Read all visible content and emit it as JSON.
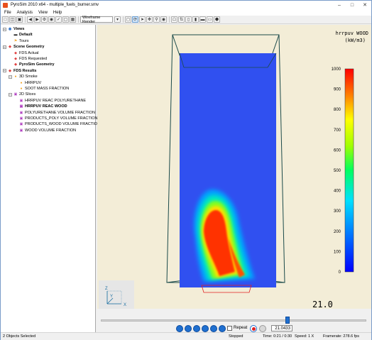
{
  "window": {
    "title": "PyroSim 2010 x64 - multiple_fuels_burner.smv"
  },
  "menu": [
    "File",
    "Analysis",
    "View",
    "Help"
  ],
  "toolbar": {
    "render_mode": "Wireframe Render"
  },
  "tree": {
    "items": [
      {
        "label": "Views",
        "bold": true,
        "icon": "views-icon",
        "level": 0
      },
      {
        "label": "Default",
        "bold": true,
        "icon": "view-icon",
        "level": 1
      },
      {
        "label": "Tours",
        "bold": false,
        "icon": "tour-icon",
        "level": 1
      },
      {
        "label": "Scene Geometry",
        "bold": true,
        "icon": "geometry-icon",
        "level": 0
      },
      {
        "label": "FDS Actual",
        "bold": false,
        "icon": "geometry-icon",
        "level": 1
      },
      {
        "label": "FDS Requested",
        "bold": false,
        "icon": "geometry-icon",
        "level": 1
      },
      {
        "label": "PyroSim Geometry",
        "bold": true,
        "icon": "geometry-icon",
        "level": 1
      },
      {
        "label": "FDS Results",
        "bold": true,
        "icon": "results-icon",
        "level": 0
      },
      {
        "label": "3D Smoke",
        "bold": false,
        "icon": "smoke-icon",
        "level": 1
      },
      {
        "label": "HRRPUV",
        "bold": false,
        "icon": "smoke-icon",
        "level": 2
      },
      {
        "label": "SOOT MASS FRACTION",
        "bold": false,
        "icon": "smoke-icon",
        "level": 2
      },
      {
        "label": "2D Slices",
        "bold": false,
        "icon": "slice-icon",
        "level": 1
      },
      {
        "label": "HRRPUV REAC POLYURETHANE",
        "bold": false,
        "icon": "slice-icon",
        "level": 2
      },
      {
        "label": "HRRPUV REAC WOOD",
        "bold": true,
        "icon": "slice-icon",
        "level": 2
      },
      {
        "label": "POLYURETHANE VOLUME FRACTION",
        "bold": false,
        "icon": "slice-icon",
        "level": 2
      },
      {
        "label": "PRODUCTS_POLY VOLUME FRACTION",
        "bold": false,
        "icon": "slice-icon",
        "level": 2
      },
      {
        "label": "PRODUCTS_WOOD VOLUME FRACTION",
        "bold": false,
        "icon": "slice-icon",
        "level": 2
      },
      {
        "label": "WOOD VOLUME FRACTION",
        "bold": false,
        "icon": "slice-icon",
        "level": 2
      }
    ]
  },
  "legend": {
    "title_line1": "hrrpuv WOOD",
    "title_line2": "(kW/m3)",
    "ticks": [
      "1000",
      "900",
      "800",
      "700",
      "600",
      "500",
      "400",
      "300",
      "200",
      "100",
      "0"
    ]
  },
  "viewport": {
    "time_readout": "21.0",
    "axis_labels": [
      "Z",
      "Y",
      "X"
    ]
  },
  "playback": {
    "repeat_label": "Repeat",
    "repeat_checked": false,
    "time_field": "21.0433"
  },
  "status": {
    "selection": "2 Objects Selected",
    "state": "Stopped",
    "time": "Time: 0:21 / 0:30",
    "speed": "Speed: 1 X",
    "framerate": "Framerate: 278.6 fps"
  },
  "colors": {
    "scale_top": "#ff0000",
    "scale_mid": "#00ff66",
    "scale_bottom": "#0000ff",
    "domain_fill": "#3050f0",
    "background": "#f3edd7"
  }
}
